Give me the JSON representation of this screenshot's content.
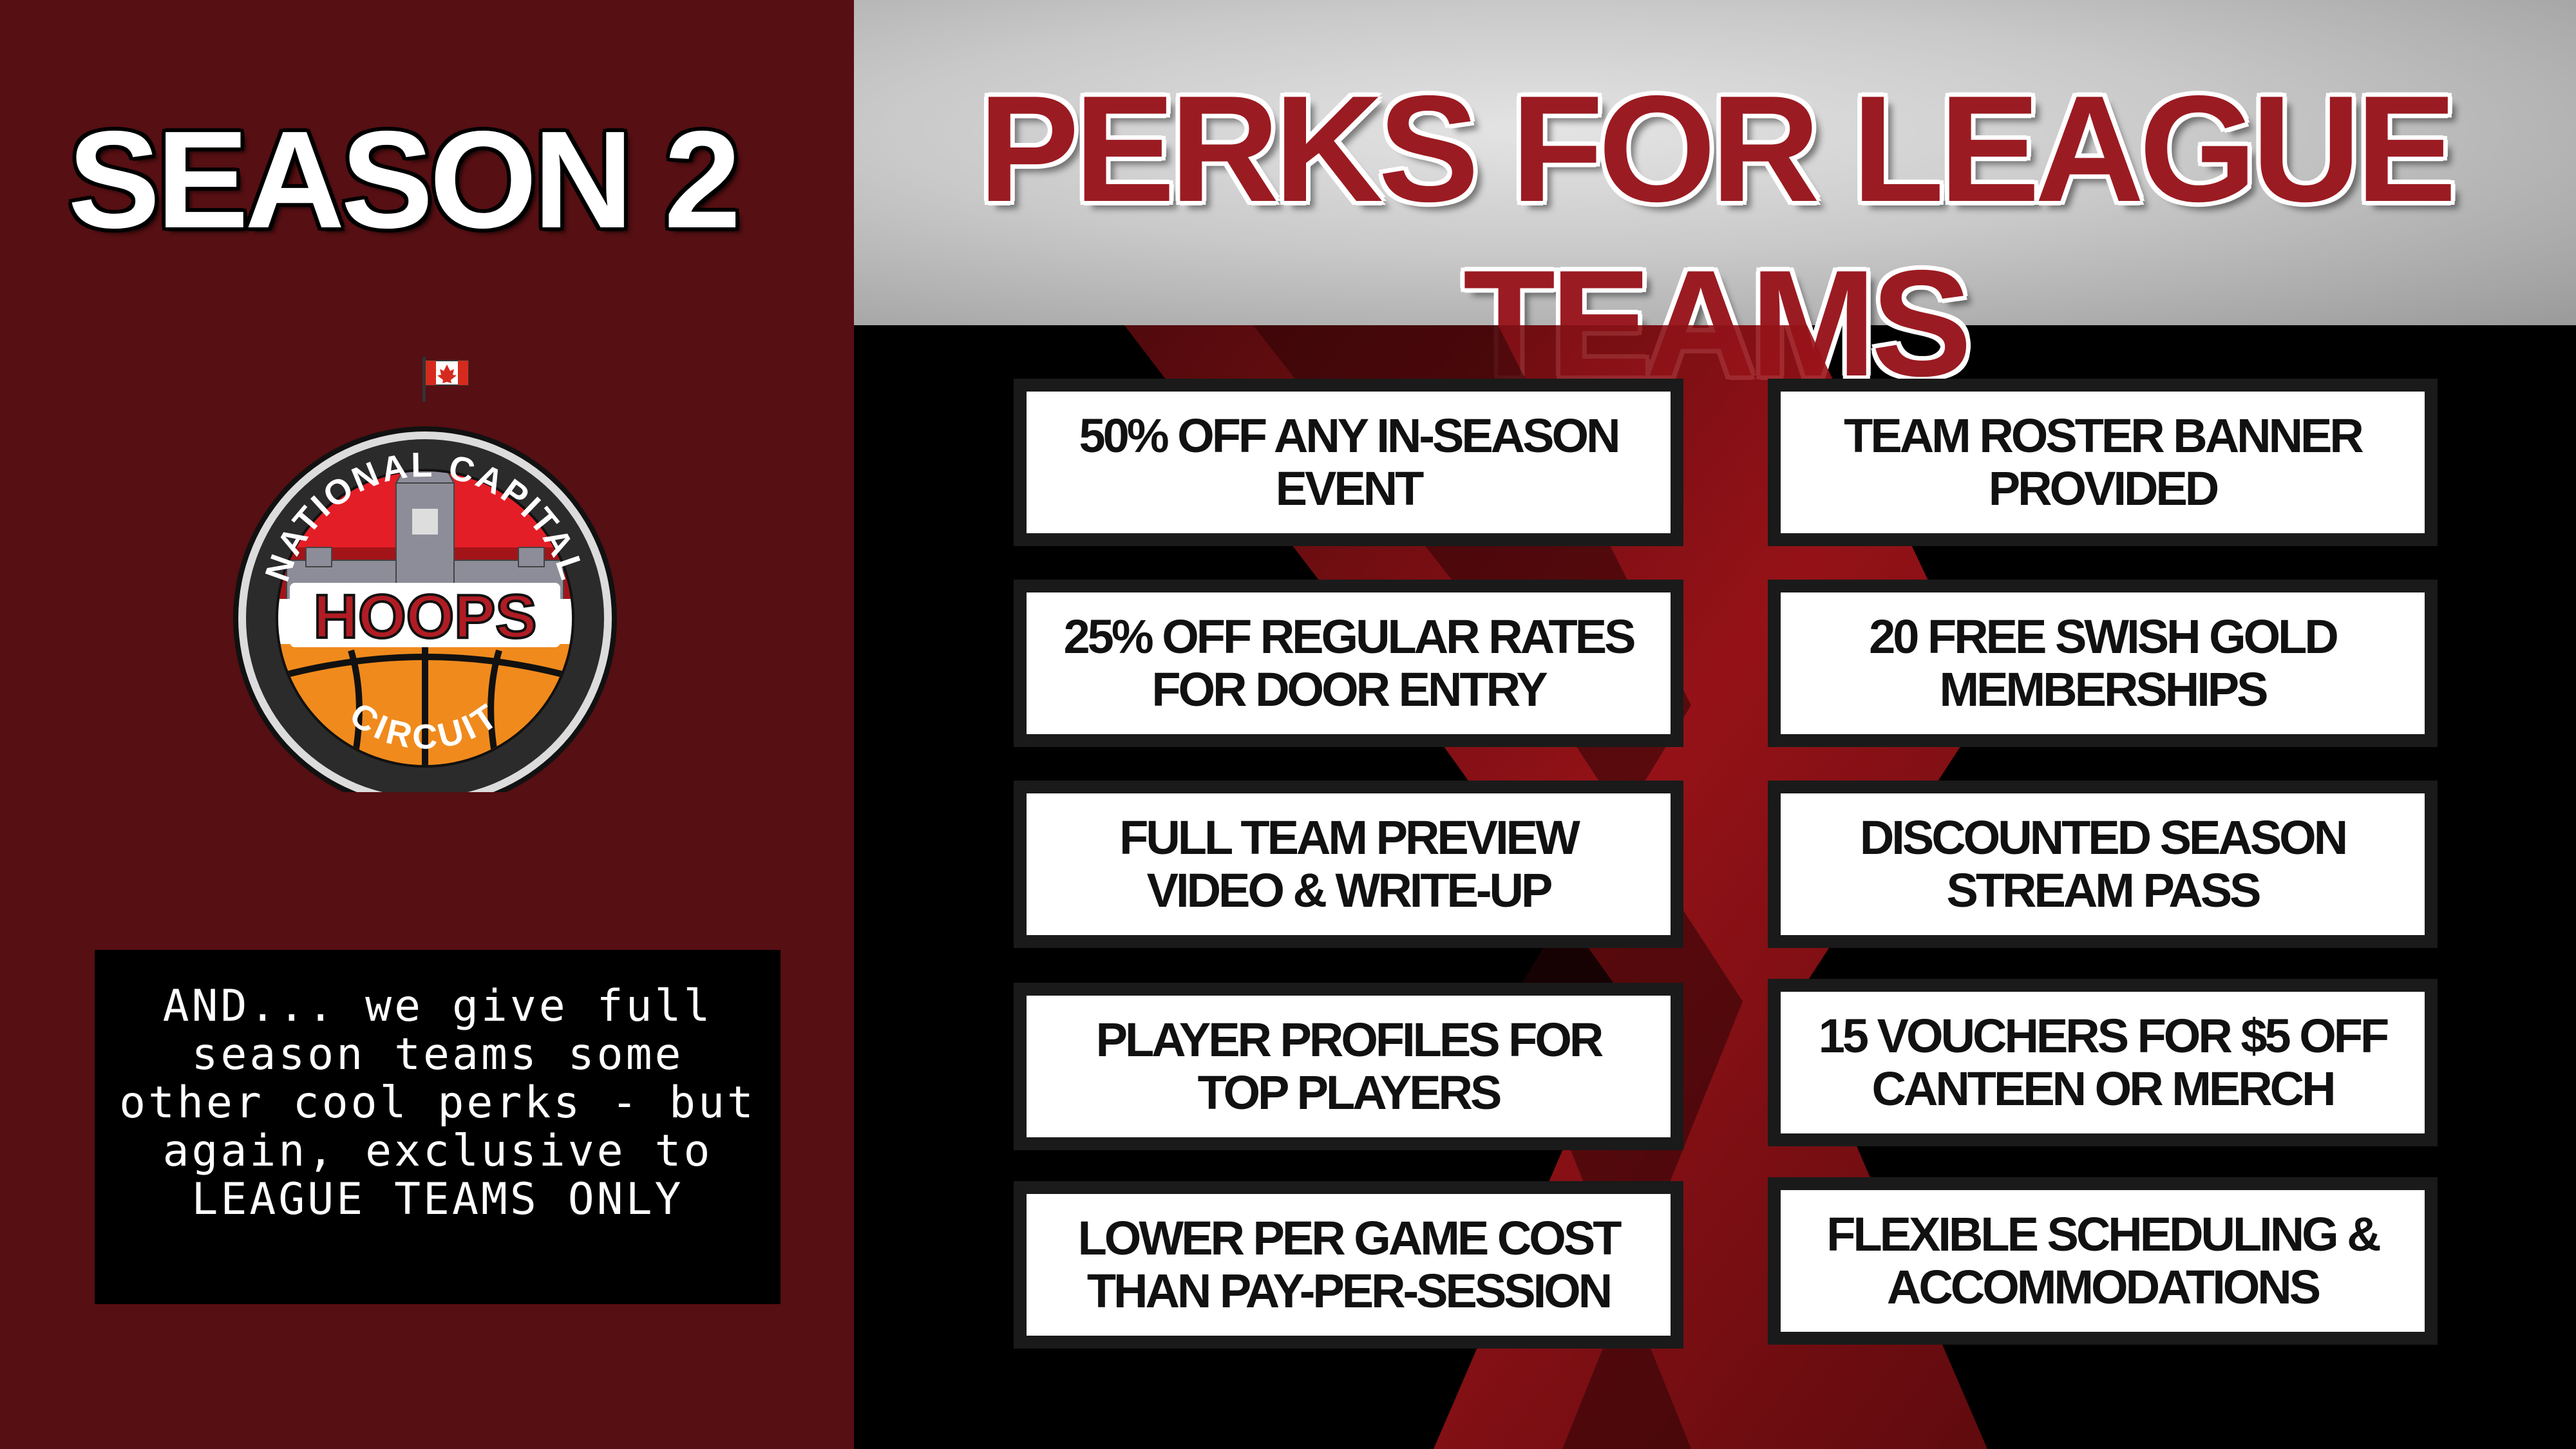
{
  "season": {
    "title": "SEASON 2"
  },
  "header": {
    "title": "PERKS FOR LEAGUE TEAMS"
  },
  "logo": {
    "top_text": "NATIONAL CAPITAL",
    "center_text": "HOOPS",
    "bottom_text": "CIRCUIT"
  },
  "note": {
    "lines": [
      "AND... we give full",
      "season teams some",
      "other cool perks - but",
      "again, exclusive to",
      "LEAGUE TEAMS ONLY"
    ]
  },
  "perks_left": [
    "50% OFF ANY IN-SEASON EVENT",
    "25% OFF REGULAR RATES FOR DOOR ENTRY",
    "FULL TEAM PREVIEW VIDEO & WRITE-UP",
    "PLAYER PROFILES FOR TOP PLAYERS",
    "LOWER PER GAME COST THAN PAY-PER-SESSION"
  ],
  "perks_right": [
    "TEAM ROSTER BANNER PROVIDED",
    "20 FREE SWISH GOLD MEMBERSHIPS",
    "DISCOUNTED SEASON STREAM PASS",
    "15 VOUCHERS FOR $5 OFF CANTEEN OR MERCH",
    "FLEXIBLE SCHEDULING & ACCOMMODATIONS"
  ],
  "colors": {
    "maroon": "#560f12",
    "accent_red": "#9b1b22",
    "flag_red": "#d52b1e"
  }
}
